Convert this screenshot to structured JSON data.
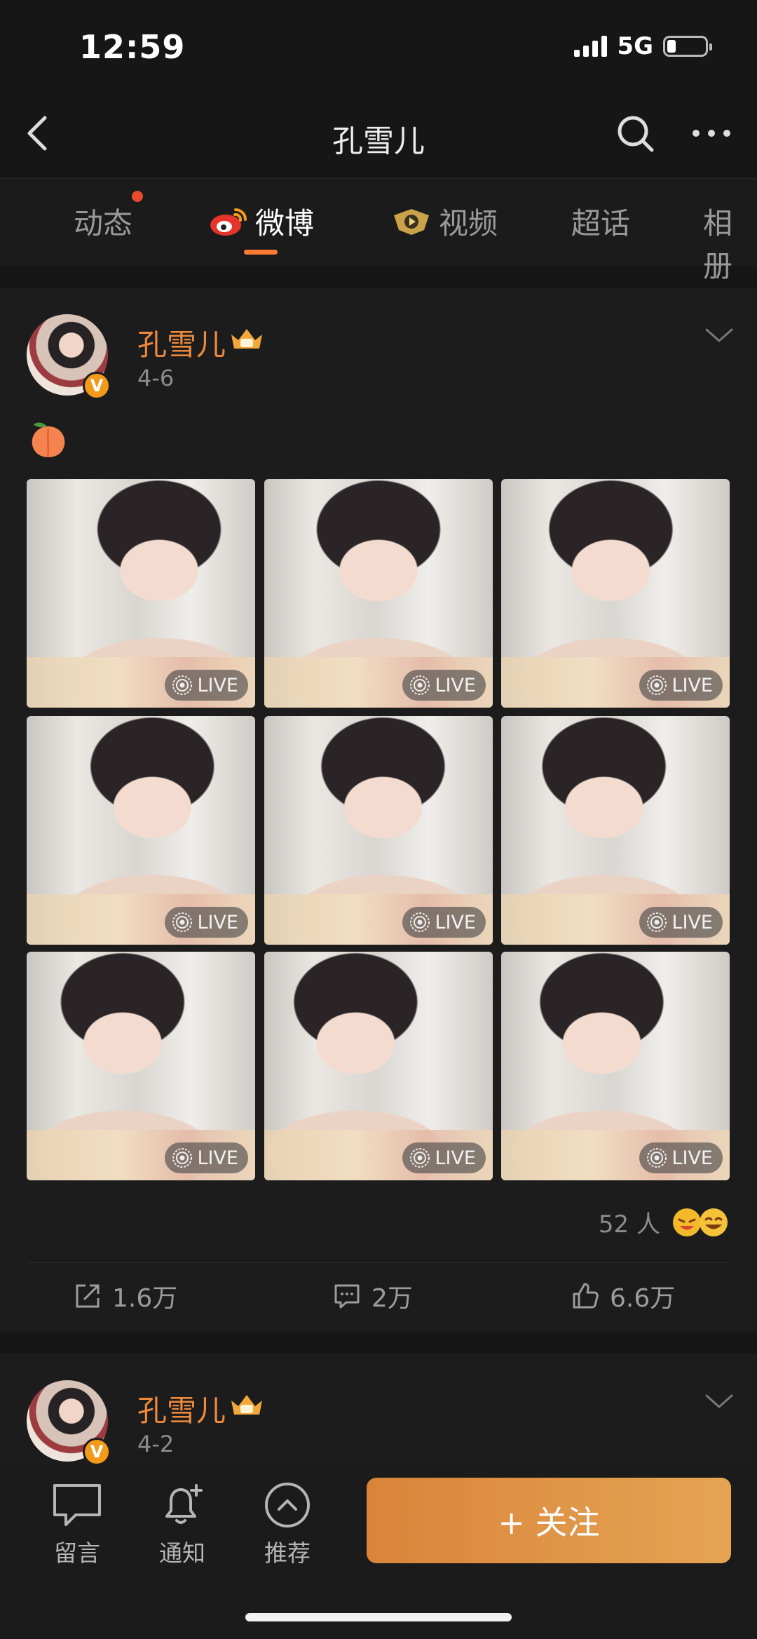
{
  "status_bar": {
    "time": "12:59",
    "network": "5G"
  },
  "nav": {
    "title": "孔雪儿",
    "icons": [
      "back-icon",
      "search-icon",
      "more-icon"
    ]
  },
  "tabs": [
    {
      "label": "动态",
      "active": false,
      "has_dot": true
    },
    {
      "label": "微博",
      "active": true,
      "icon": "weibo-icon"
    },
    {
      "label": "视频",
      "active": false,
      "icon": "video-badge-icon"
    },
    {
      "label": "超话",
      "active": false
    },
    {
      "label": "相册",
      "active": false
    }
  ],
  "posts": [
    {
      "author": "孔雪儿",
      "date": "4-6",
      "content_emoji": "peach-emoji",
      "photos": [
        {
          "badge": "LIVE"
        },
        {
          "badge": "LIVE"
        },
        {
          "badge": "LIVE"
        },
        {
          "badge": "LIVE"
        },
        {
          "badge": "LIVE"
        },
        {
          "badge": "LIVE"
        },
        {
          "badge": "LIVE"
        },
        {
          "badge": "LIVE"
        },
        {
          "badge": "LIVE"
        }
      ],
      "reactions": {
        "count": "52 人"
      },
      "actions": {
        "repost": "1.6万",
        "comment": "2万",
        "like": "6.6万"
      }
    },
    {
      "author": "孔雪儿",
      "date": "4-2"
    }
  ],
  "bottom_bar": {
    "comment_label": "留言",
    "notify_label": "通知",
    "recommend_label": "推荐",
    "follow_label": "+ 关注"
  },
  "colors": {
    "accent": "#ff7b33",
    "author": "#ee8a3c",
    "follow_button": "#e09a48",
    "background": "#161616"
  }
}
